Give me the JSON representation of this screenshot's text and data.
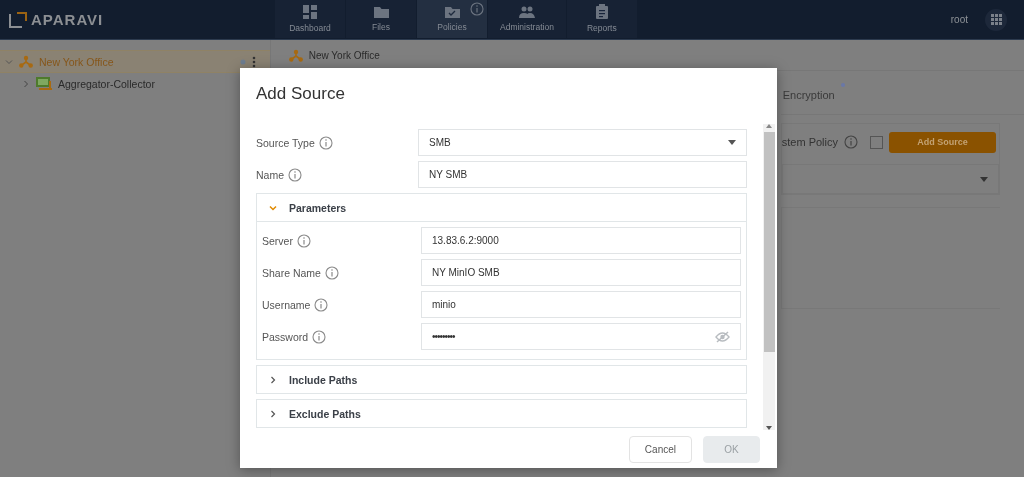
{
  "header": {
    "logo": "APARAVI",
    "nav": [
      {
        "label": "Dashboard",
        "kind": "dashboard",
        "selected": false,
        "info": false
      },
      {
        "label": "Files",
        "kind": "folder",
        "selected": false,
        "info": false
      },
      {
        "label": "Policies",
        "kind": "policy",
        "selected": true,
        "info": true
      },
      {
        "label": "Administration",
        "kind": "people",
        "selected": false,
        "info": false
      },
      {
        "label": "Reports",
        "kind": "report",
        "selected": false,
        "info": false
      }
    ],
    "user": "root"
  },
  "tree": [
    {
      "label": "New York Office",
      "kind": "network",
      "selected": true,
      "expanded": true,
      "children": [
        {
          "label": "Aggregator-Collector",
          "kind": "collector",
          "selected": false,
          "expanded": false
        }
      ]
    }
  ],
  "breadcrumb": "New York Office",
  "background_panel": {
    "tab": "Encryption",
    "policy_label": "stem Policy",
    "policy_checked": false,
    "add_button": "Add Source"
  },
  "dialog": {
    "title": "Add Source",
    "fields": [
      {
        "label": "Source Type",
        "kind": "select",
        "value": "SMB"
      },
      {
        "label": "Name",
        "kind": "text",
        "value": "NY SMB"
      }
    ],
    "sections": [
      {
        "title": "Parameters",
        "expanded": true,
        "fields": [
          {
            "label": "Server",
            "kind": "text",
            "value": "13.83.6.2:9000"
          },
          {
            "label": "Share Name",
            "kind": "text",
            "value": "NY MinIO SMB"
          },
          {
            "label": "Username",
            "kind": "text",
            "value": "minio"
          },
          {
            "label": "Password",
            "kind": "password",
            "value": "•••••••••"
          }
        ]
      },
      {
        "title": "Include Paths",
        "expanded": false
      },
      {
        "title": "Exclude Paths",
        "expanded": false
      }
    ],
    "buttons": [
      {
        "label": "Cancel",
        "disabled": false
      },
      {
        "label": "OK",
        "disabled": true
      }
    ]
  }
}
